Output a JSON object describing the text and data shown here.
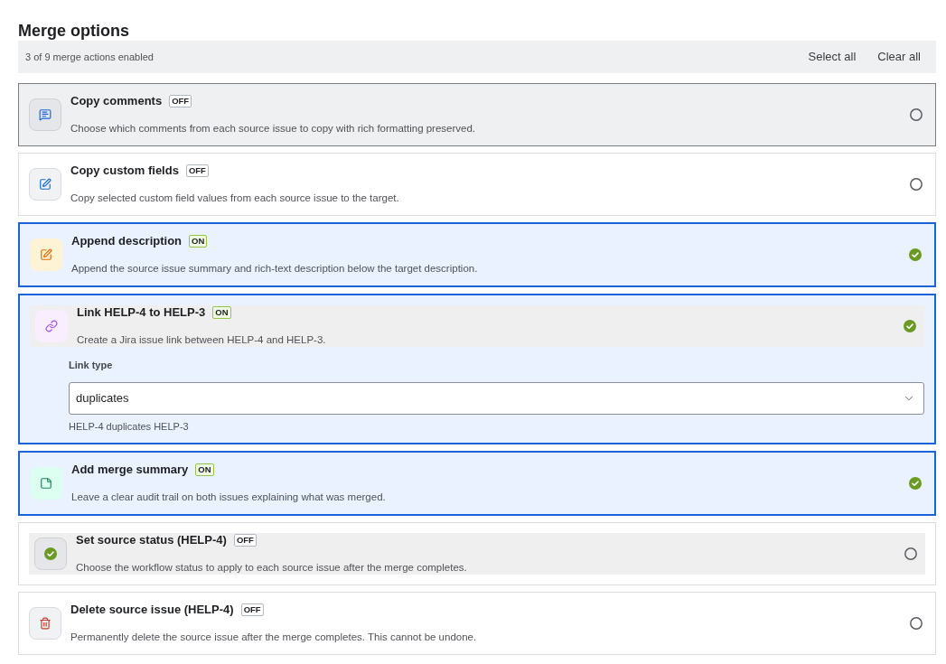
{
  "title": "Merge options",
  "summary_bar": {
    "text": "3 of 9 merge actions enabled",
    "actions": [
      "Select all",
      "Clear all"
    ]
  },
  "items": [
    {
      "title": "Copy comments",
      "badge": "OFF",
      "description": "Choose which comments from each source issue to copy with rich formatting preserved.",
      "enabled": false,
      "focused": true,
      "hovered": false
    },
    {
      "title": "Copy custom fields",
      "badge": "OFF",
      "description": "Copy selected custom field values from each source issue to the target.",
      "enabled": false,
      "focused": false,
      "hovered": false
    },
    {
      "title": "Append description",
      "badge": "ON",
      "description": "Append the source issue summary and rich-text description below the target description.",
      "enabled": true,
      "focused": false,
      "hovered": false
    },
    {
      "title": "Link HELP-4 to HELP-3",
      "badge": "ON",
      "description": "Create a Jira issue link between HELP-4 and HELP-3.",
      "enabled": true,
      "focused": false,
      "hovered": true,
      "link_type": {
        "label": "Link type",
        "value": "duplicates",
        "helper_text": "HELP-4 duplicates HELP-3"
      }
    },
    {
      "title": "Add merge summary",
      "badge": "ON",
      "description": "Leave a clear audit trail on both issues explaining what was merged.",
      "enabled": true,
      "focused": false,
      "hovered": false
    },
    {
      "title": "Set source status (HELP-4)",
      "badge": "OFF",
      "description": "Choose the workflow status to apply to each source issue after the merge completes.",
      "enabled": false,
      "focused": false,
      "hovered": true
    },
    {
      "title": "Delete source issue (HELP-4)",
      "badge": "OFF",
      "description": "Permanently delete the source issue after the merge completes. This cannot be undone.",
      "enabled": false,
      "focused": false,
      "hovered": false
    }
  ]
}
